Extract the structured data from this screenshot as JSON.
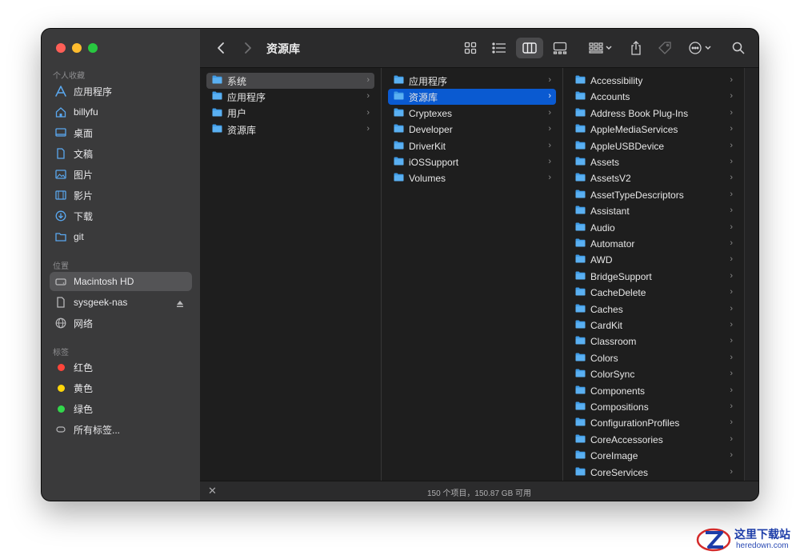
{
  "window": {
    "title": "资源库",
    "colors": {
      "close": "#ff5f57",
      "minimize": "#febc2e",
      "zoom": "#28c840",
      "accent": "#0a5ad1"
    }
  },
  "toolbar": {
    "icons": [
      "back-icon",
      "forward-icon",
      "icon-view-icon",
      "list-view-icon",
      "column-view-icon",
      "gallery-view-icon",
      "group-icon",
      "share-icon",
      "tag-icon",
      "more-icon",
      "search-icon"
    ]
  },
  "sidebar": {
    "favorites_header": "个人收藏",
    "favorites": [
      {
        "label": "应用程序",
        "icon": "applications-icon"
      },
      {
        "label": "billyfu",
        "icon": "home-icon"
      },
      {
        "label": "桌面",
        "icon": "desktop-icon"
      },
      {
        "label": "文稿",
        "icon": "document-icon"
      },
      {
        "label": "图片",
        "icon": "pictures-icon"
      },
      {
        "label": "影片",
        "icon": "movies-icon"
      },
      {
        "label": "下载",
        "icon": "downloads-icon"
      },
      {
        "label": "git",
        "icon": "folder-icon"
      }
    ],
    "locations_header": "位置",
    "locations": [
      {
        "label": "Macintosh HD",
        "icon": "disk-icon"
      },
      {
        "label": "sysgeek-nas",
        "icon": "server-icon"
      },
      {
        "label": "网络",
        "icon": "network-icon"
      }
    ],
    "tags_header": "标签",
    "tags": [
      {
        "label": "红色",
        "color": "#ff453a"
      },
      {
        "label": "黄色",
        "color": "#ffd60a"
      },
      {
        "label": "绿色",
        "color": "#32d74b"
      },
      {
        "label": "所有标签...",
        "color": ""
      }
    ]
  },
  "columns": [
    {
      "items": [
        "系统",
        "应用程序",
        "用户",
        "资源库"
      ],
      "selected": 0,
      "selected_style": "grey"
    },
    {
      "items": [
        "应用程序",
        "资源库",
        "Cryptexes",
        "Developer",
        "DriverKit",
        "iOSSupport",
        "Volumes"
      ],
      "selected": 1,
      "selected_style": "blue"
    },
    {
      "items": [
        "Accessibility",
        "Accounts",
        "Address Book Plug-Ins",
        "AppleMediaServices",
        "AppleUSBDevice",
        "Assets",
        "AssetsV2",
        "AssetTypeDescriptors",
        "Assistant",
        "Audio",
        "Automator",
        "AWD",
        "BridgeSupport",
        "CacheDelete",
        "Caches",
        "CardKit",
        "Classroom",
        "Colors",
        "ColorSync",
        "Components",
        "Compositions",
        "ConfigurationProfiles",
        "CoreAccessories",
        "CoreImage",
        "CoreServices"
      ],
      "selected": -1,
      "selected_style": ""
    }
  ],
  "statusbar": {
    "text": "150 个项目，150.87 GB 可用"
  },
  "watermark": {
    "title": "这里下载站",
    "url": "heredown.com"
  }
}
